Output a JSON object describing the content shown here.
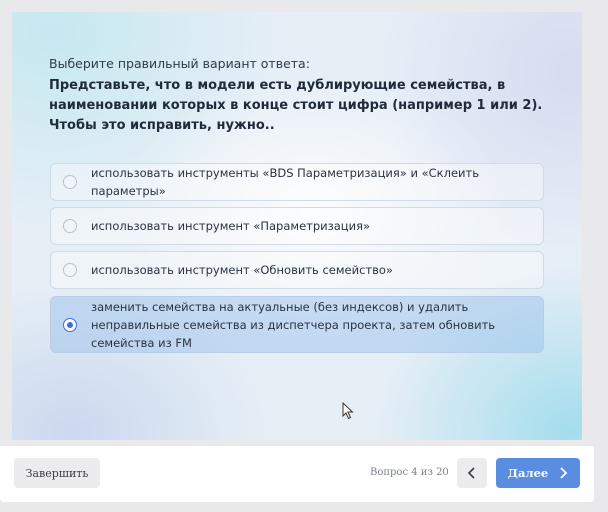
{
  "quiz": {
    "prompt": "Выберите правильный вариант ответа:",
    "question": "Представьте, что в модели есть дублирующие семейства, в наименовании которых в конце стоит цифра (например 1 или 2). Чтобы это исправить, нужно..",
    "options": [
      {
        "label": "использовать инструменты «BDS Параметризация» и «Склеить параметры»",
        "selected": false
      },
      {
        "label": "использовать инструмент «Параметризация»",
        "selected": false
      },
      {
        "label": "использовать инструмент «Обновить семейство»",
        "selected": false
      },
      {
        "label": "заменить семейства на актуальные (без индексов) и удалить неправильные семейства из диспетчера проекта, затем обновить семейства из FM",
        "selected": true
      }
    ]
  },
  "footer": {
    "finish_label": "Завершить",
    "counter": "Вопрос 4 из 20",
    "next_label": "Далее",
    "prev_icon": "chevron-left-icon",
    "next_icon": "chevron-right-icon"
  },
  "colors": {
    "accent": "#5a8de0",
    "radio_selected": "#3b6fd6"
  }
}
